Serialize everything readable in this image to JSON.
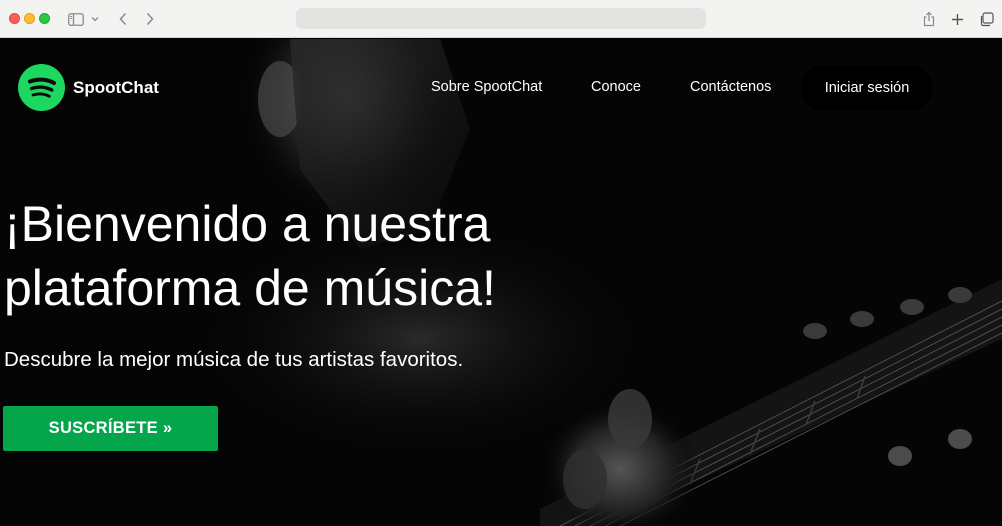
{
  "browser": {
    "address_text": ""
  },
  "navbar": {
    "brand_name": "SpootChat",
    "links": [
      {
        "label": "Sobre SpootChat"
      },
      {
        "label": "Conoce"
      },
      {
        "label": "Contáctenos"
      }
    ],
    "login_label": "Iniciar sesión"
  },
  "hero": {
    "title_line1": "¡Bienvenido a nuestra",
    "title_line2": "plataforma de música!",
    "subtitle": "Descubre la mejor música de tus artistas favoritos.",
    "cta_label": "SUSCRÍBETE »"
  },
  "colors": {
    "brand_green": "#1ed760",
    "cta_green": "#05a54c",
    "background": "#000000"
  },
  "icons": [
    "sidebar-icon",
    "chevron-down-icon",
    "back-icon",
    "forward-icon",
    "share-icon",
    "new-tab-icon",
    "tab-overview-icon",
    "spotify-logo-icon"
  ]
}
